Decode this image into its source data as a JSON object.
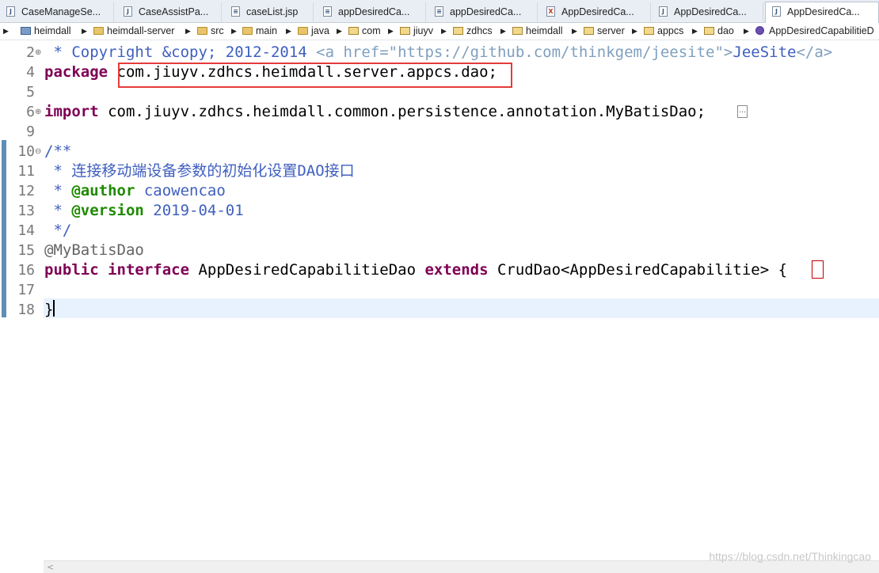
{
  "tabs": [
    {
      "label": "CaseManageSe...",
      "icon": "java-file-icon"
    },
    {
      "label": "CaseAssistPa...",
      "icon": "java-file-icon"
    },
    {
      "label": "caseList.jsp",
      "icon": "jsp-file-icon"
    },
    {
      "label": "appDesiredCa...",
      "icon": "jsp-file-icon"
    },
    {
      "label": "appDesiredCa...",
      "icon": "jsp-file-icon"
    },
    {
      "label": "AppDesiredCa...",
      "icon": "xml-file-icon"
    },
    {
      "label": "AppDesiredCa...",
      "icon": "java-file-icon"
    },
    {
      "label": "AppDesiredCa...",
      "icon": "java-file-icon",
      "active": true
    }
  ],
  "breadcrumb": [
    {
      "label": "heimdall",
      "icon": "project-icon"
    },
    {
      "label": "heimdall-server",
      "icon": "folder-icon"
    },
    {
      "label": "src",
      "icon": "folder-icon"
    },
    {
      "label": "main",
      "icon": "folder-icon"
    },
    {
      "label": "java",
      "icon": "folder-icon"
    },
    {
      "label": "com",
      "icon": "package-icon"
    },
    {
      "label": "jiuyv",
      "icon": "package-icon"
    },
    {
      "label": "zdhcs",
      "icon": "package-icon"
    },
    {
      "label": "heimdall",
      "icon": "package-icon"
    },
    {
      "label": "server",
      "icon": "package-icon"
    },
    {
      "label": "appcs",
      "icon": "package-icon"
    },
    {
      "label": "dao",
      "icon": "package-icon"
    },
    {
      "label": "AppDesiredCapabilitieD",
      "icon": "interface-icon"
    }
  ],
  "code": {
    "lines": [
      {
        "num": "2",
        "fold": "⊕",
        "parts": [
          [
            "cm",
            " * Copyright &copy; 2012-2014 "
          ],
          [
            "cmtag",
            "<a href=\"https://github.com/thinkgem/jeesite\">"
          ],
          [
            "cm",
            "JeeSite"
          ],
          [
            "cmtag",
            "</a>"
          ]
        ]
      },
      {
        "num": "4",
        "fold": "",
        "parts": [
          [
            "kw",
            "package"
          ],
          [
            "pl",
            " com.jiuyv.zdhcs.heimdall.server.appcs.dao;"
          ]
        ]
      },
      {
        "num": "5",
        "fold": "",
        "parts": []
      },
      {
        "num": "6",
        "fold": "⊕",
        "parts": [
          [
            "kw",
            "import"
          ],
          [
            "pl",
            " com.jiuyv.zdhcs.heimdall.common.persistence.annotation.MyBatisDao;"
          ]
        ]
      },
      {
        "num": "9",
        "fold": "",
        "parts": []
      },
      {
        "num": "10",
        "fold": "⊖",
        "parts": [
          [
            "cm",
            "/**"
          ]
        ]
      },
      {
        "num": "11",
        "fold": "",
        "parts": [
          [
            "cm",
            " * 连接移动端设备参数的初始化设置DAO接口"
          ]
        ]
      },
      {
        "num": "12",
        "fold": "",
        "parts": [
          [
            "cm",
            " * "
          ],
          [
            "doctag",
            "@author"
          ],
          [
            "cm",
            " caowencao"
          ]
        ]
      },
      {
        "num": "13",
        "fold": "",
        "parts": [
          [
            "cm",
            " * "
          ],
          [
            "doctag",
            "@version"
          ],
          [
            "cm",
            " 2019-04-01"
          ]
        ]
      },
      {
        "num": "14",
        "fold": "",
        "parts": [
          [
            "cm",
            " */"
          ]
        ]
      },
      {
        "num": "15",
        "fold": "",
        "parts": [
          [
            "ann",
            "@MyBatisDao"
          ]
        ]
      },
      {
        "num": "16",
        "fold": "",
        "parts": [
          [
            "kw",
            "public"
          ],
          [
            "pl",
            " "
          ],
          [
            "kw",
            "interface"
          ],
          [
            "pl",
            " AppDesiredCapabilitieDao "
          ],
          [
            "kw",
            "extends"
          ],
          [
            "pl",
            " CrudDao<AppDesiredCapabilitie> {"
          ]
        ]
      },
      {
        "num": "17",
        "fold": "",
        "parts": []
      },
      {
        "num": "18",
        "fold": "",
        "parts": [
          [
            "pl",
            "}"
          ]
        ]
      }
    ]
  },
  "watermark": "https://blog.csdn.net/Thinkingcao",
  "colors": {
    "keyword": "#7f0055",
    "comment": "#3f5fbf",
    "doc_tag": "#1f8a00",
    "highlight_box": "#e53b3b",
    "current_line": "#e8f2fe"
  }
}
